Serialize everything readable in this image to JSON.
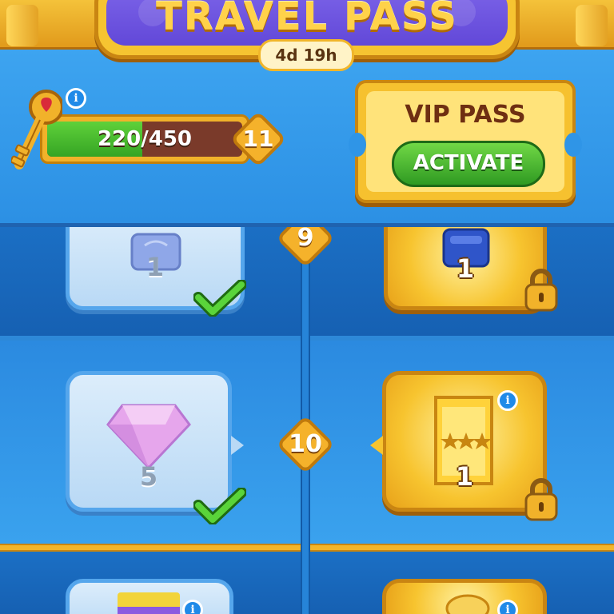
{
  "banner": {
    "title": "TRAVEL PASS",
    "timer": "4d 19h"
  },
  "progress": {
    "current": 220,
    "max": 450,
    "label": "220/450",
    "level": "11",
    "info_icon": "info-icon"
  },
  "vip": {
    "title": "VIP PASS",
    "activate_label": "ACTIVATE"
  },
  "rows": [
    {
      "level": "9",
      "free_reward": {
        "item": "blue-chest",
        "count": "1",
        "claimed": true
      },
      "vip_reward": {
        "item": "blue-chest",
        "count": "1",
        "locked": true
      }
    },
    {
      "level": "10",
      "free_reward": {
        "item": "pink-gem",
        "count": "5",
        "claimed": true
      },
      "vip_reward": {
        "item": "gold-ticket",
        "count": "1",
        "locked": true,
        "has_info": true
      }
    },
    {
      "level": "",
      "free_reward": {
        "item": "rainbow-card",
        "count": "",
        "has_info": true
      },
      "vip_reward": {
        "item": "gold-reward",
        "count": "",
        "has_info": true
      }
    }
  ],
  "colors": {
    "gold": "#f6c12f",
    "purple": "#6a50dc",
    "blue": "#2c90e4",
    "green": "#35a424"
  }
}
